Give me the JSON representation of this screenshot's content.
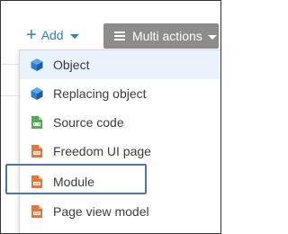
{
  "toolbar": {
    "add_label": "Add",
    "multi_actions_label": "Multi actions"
  },
  "menu": {
    "items": [
      {
        "label": "Object",
        "icon": "object-cube-icon"
      },
      {
        "label": "Replacing object",
        "icon": "replacing-object-cube-icon"
      },
      {
        "label": "Source code",
        "icon": "source-code-file-icon"
      },
      {
        "label": "Freedom UI page",
        "icon": "freedom-ui-page-file-icon"
      },
      {
        "label": "Module",
        "icon": "module-file-icon"
      },
      {
        "label": "Page view model",
        "icon": "page-view-model-file-icon"
      }
    ]
  },
  "colors": {
    "accent": "#2b7fd0",
    "multi_actions_bg": "#8c8c8c",
    "highlight_border": "#4a76b8",
    "file_icon_orange": "#e8743b",
    "file_icon_green": "#4caf50",
    "cube_blue": "#2b7fd0"
  }
}
